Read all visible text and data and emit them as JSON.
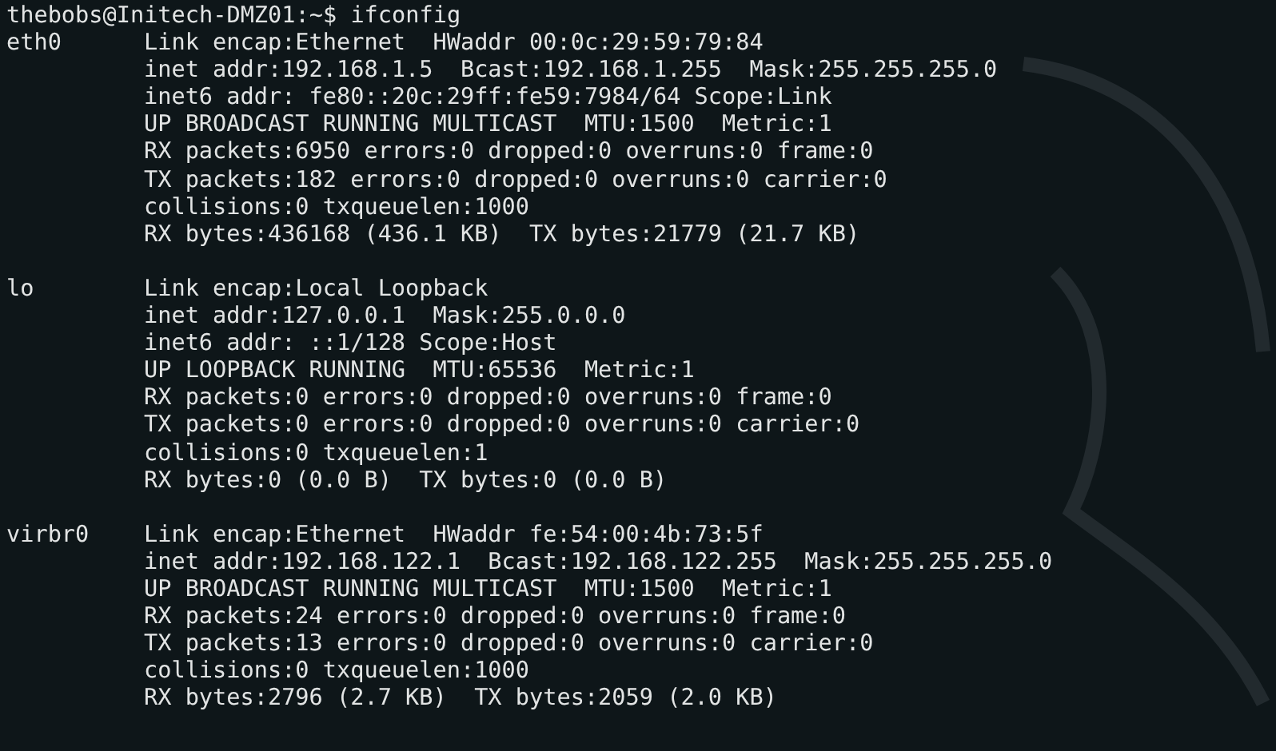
{
  "terminal": {
    "prompt": "thebobs@Initech-DMZ01:~$",
    "command": "ifconfig",
    "interfaces": [
      {
        "name": "eth0",
        "lines": [
          "Link encap:Ethernet  HWaddr 00:0c:29:59:79:84",
          "inet addr:192.168.1.5  Bcast:192.168.1.255  Mask:255.255.255.0",
          "inet6 addr: fe80::20c:29ff:fe59:7984/64 Scope:Link",
          "UP BROADCAST RUNNING MULTICAST  MTU:1500  Metric:1",
          "RX packets:6950 errors:0 dropped:0 overruns:0 frame:0",
          "TX packets:182 errors:0 dropped:0 overruns:0 carrier:0",
          "collisions:0 txqueuelen:1000",
          "RX bytes:436168 (436.1 KB)  TX bytes:21779 (21.7 KB)"
        ]
      },
      {
        "name": "lo",
        "lines": [
          "Link encap:Local Loopback",
          "inet addr:127.0.0.1  Mask:255.0.0.0",
          "inet6 addr: ::1/128 Scope:Host",
          "UP LOOPBACK RUNNING  MTU:65536  Metric:1",
          "RX packets:0 errors:0 dropped:0 overruns:0 frame:0",
          "TX packets:0 errors:0 dropped:0 overruns:0 carrier:0",
          "collisions:0 txqueuelen:1",
          "RX bytes:0 (0.0 B)  TX bytes:0 (0.0 B)"
        ]
      },
      {
        "name": "virbr0",
        "lines": [
          "Link encap:Ethernet  HWaddr fe:54:00:4b:73:5f",
          "inet addr:192.168.122.1  Bcast:192.168.122.255  Mask:255.255.255.0",
          "UP BROADCAST RUNNING MULTICAST  MTU:1500  Metric:1",
          "RX packets:24 errors:0 dropped:0 overruns:0 frame:0",
          "TX packets:13 errors:0 dropped:0 overruns:0 carrier:0",
          "collisions:0 txqueuelen:1000",
          "RX bytes:2796 (2.7 KB)  TX bytes:2059 (2.0 KB)"
        ]
      }
    ]
  }
}
